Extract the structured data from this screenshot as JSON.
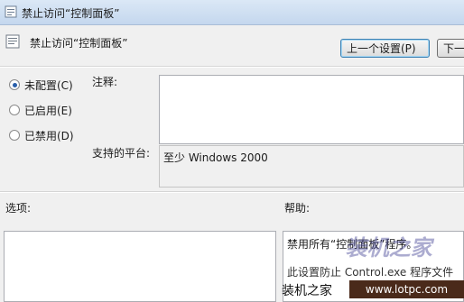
{
  "window": {
    "title": "禁止访问“控制面板”"
  },
  "header": {
    "title": "禁止访问“控制面板”",
    "prev_button": "上一个设置(P)",
    "next_button": "下一"
  },
  "radios": [
    {
      "label": "未配置(C)",
      "checked": true
    },
    {
      "label": "已启用(E)",
      "checked": false
    },
    {
      "label": "已禁用(D)",
      "checked": false
    }
  ],
  "comment": {
    "label": "注释:",
    "value": ""
  },
  "platform": {
    "label": "支持的平台:",
    "value": "至少 Windows 2000"
  },
  "options": {
    "label": "选项:"
  },
  "help": {
    "label": "帮助:",
    "line1": "禁用所有“控制面板”程序。",
    "line2": "此设置防止 Control.exe 程序文件"
  },
  "watermark": {
    "big": "装机之家",
    "site": "装机之家",
    "url": "www.lotpc.com"
  },
  "colors": {
    "titlebar": "#c4d7ee",
    "accent": "#3c7fb1",
    "background": "#f0f0f0"
  }
}
